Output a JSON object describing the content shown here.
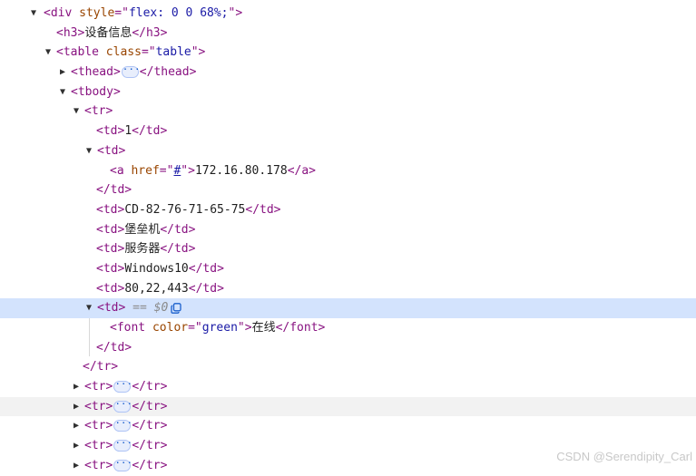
{
  "dom": {
    "div_open": {
      "tag": "div",
      "attr": "style",
      "value": "flex: 0 0 68%;"
    },
    "h3": {
      "open": "<h3>",
      "text": "设备信息",
      "close": "</h3>"
    },
    "table_open": {
      "tag": "table",
      "attr": "class",
      "value": "table"
    },
    "thead": {
      "open": "<thead>",
      "close": "</thead>"
    },
    "tbody": {
      "open": "<tbody>"
    },
    "tr_open": "<tr>",
    "tr_close": "</tr>",
    "td_open": "<td>",
    "td_close": "</td>",
    "td_close_mid": "</td>",
    "cells": {
      "c1": "1",
      "c2_link": {
        "tag": "a",
        "attr": "href",
        "value": "#",
        "text": "172.16.80.178",
        "close": "</a>"
      },
      "c3": "CD-82-76-71-65-75",
      "c4": "堡垒机",
      "c5": "服务器",
      "c6": "Windows10",
      "c7": "80,22,443"
    },
    "selected": {
      "open": "<td>",
      "marker": "== $0"
    },
    "font": {
      "tag": "font",
      "attr": "color",
      "value": "green",
      "text": "在线",
      "close": "</font>"
    },
    "collapsed_tr": {
      "open": "<tr>",
      "close": "</tr>"
    }
  },
  "icons": {
    "expanded": "expanded-triangle-icon",
    "collapsed": "collapsed-triangle-icon",
    "ellipsis": "ellipsis-icon",
    "copy": "copy-icon"
  },
  "colors": {
    "tag": "#881280",
    "attr_name": "#994500",
    "attr_value": "#1a1aa6",
    "selected_row": "#d3e3fd"
  },
  "watermark": "CSDN @Serendipity_Carl"
}
